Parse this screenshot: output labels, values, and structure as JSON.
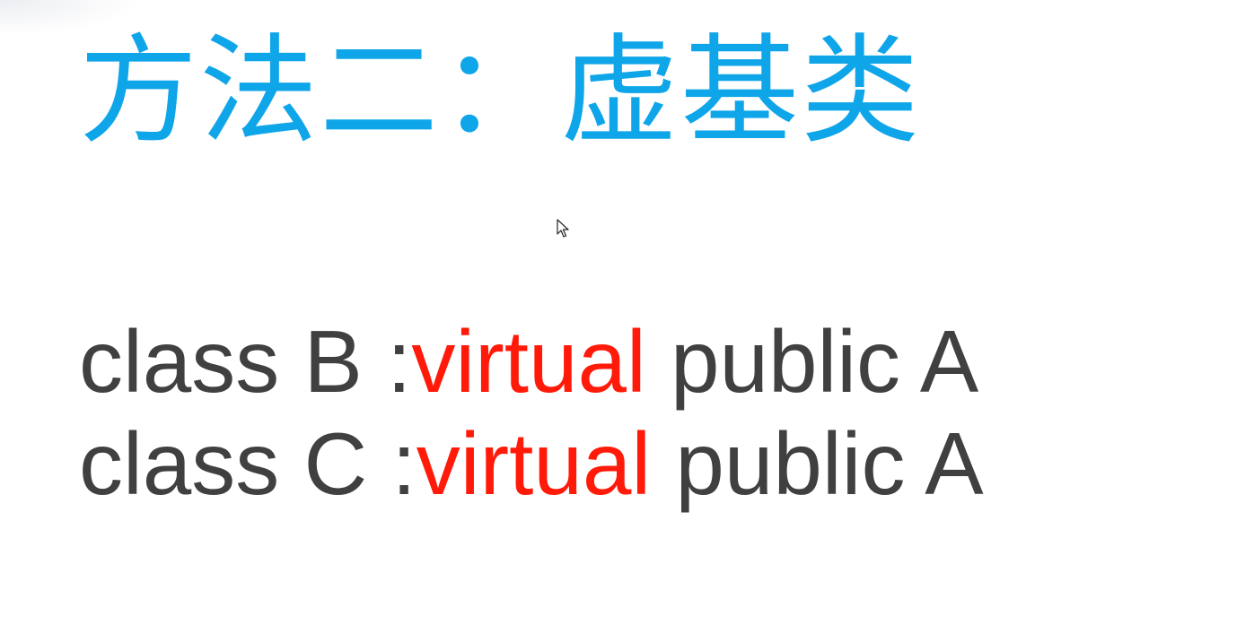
{
  "slide": {
    "title": "方法二：虚基类",
    "lines": [
      {
        "prefix": "class B :",
        "keyword": "virtual",
        "suffix": " public A"
      },
      {
        "prefix": "class C :",
        "keyword": "virtual",
        "suffix": " public A"
      }
    ]
  },
  "colors": {
    "title": "#0fa5e9",
    "text": "#404040",
    "keyword": "#ff1a0a",
    "background": "#ffffff"
  },
  "icons": {
    "cursor": "mouse-pointer-icon"
  }
}
